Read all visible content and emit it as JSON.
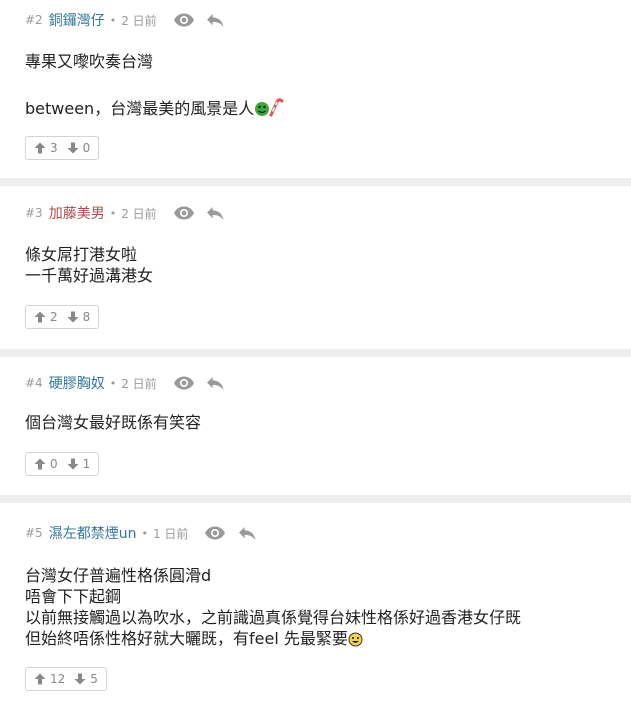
{
  "posts": [
    {
      "number": "#2",
      "author": "銅鑼灣仔",
      "separator": "•",
      "time": "2 日前",
      "lines": [
        "專果又嚟吹奏台灣",
        "between，台灣最美的風景是人"
      ],
      "upvotes": "3",
      "downvotes": "0"
    },
    {
      "number": "#3",
      "author": "加藤美男",
      "separator": "•",
      "time": "2 日前",
      "lines": [
        "條女屌打港女啦",
        "一千萬好過溝港女"
      ],
      "upvotes": "2",
      "downvotes": "8"
    },
    {
      "number": "#4",
      "author": "硬膠胸奴",
      "separator": "•",
      "time": "2 日前",
      "lines": [
        "個台灣女最好既係有笑容"
      ],
      "upvotes": "0",
      "downvotes": "1"
    },
    {
      "number": "#5",
      "author": "濕左都禁煙un",
      "separator": "•",
      "time": "1 日前",
      "lines": [
        "台灣女仔普遍性格係圓滑d",
        "唔會下下起鋼",
        "以前無接觸過以為吹水，之前識過真係覺得台妹性格係好過香港女仔既",
        "但始終唔係性格好就大曬既，有feel 先最緊要"
      ],
      "upvotes": "12",
      "downvotes": "5"
    }
  ],
  "colors": {
    "author_blue": "#34789e",
    "author_red": "#b24b4b",
    "muted": "#9a9a9a"
  },
  "icons": {
    "view": "eye-icon",
    "reply": "reply-arrow-icon",
    "upvote": "thumbs-up-icon",
    "downvote": "thumbs-down-icon",
    "emoticon_1": "green-face-candy-cane-emoticon",
    "emoticon_2": "grinning-face-emoticon"
  }
}
